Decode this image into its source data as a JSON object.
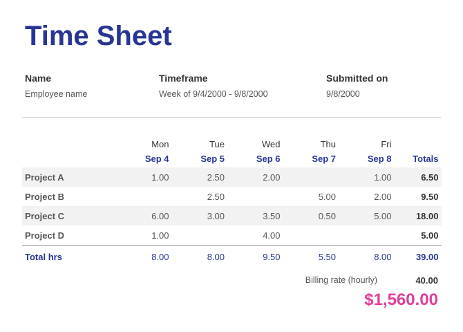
{
  "title": "Time Sheet",
  "meta": {
    "name_label": "Name",
    "name_value": "Employee name",
    "timeframe_label": "Timeframe",
    "timeframe_value": "Week of 9/4/2000 - 9/8/2000",
    "submitted_label": "Submitted on",
    "submitted_value": "9/8/2000"
  },
  "columns": {
    "days": [
      "Mon",
      "Tue",
      "Wed",
      "Thu",
      "Fri"
    ],
    "dates": [
      "Sep 4",
      "Sep 5",
      "Sep 6",
      "Sep 7",
      "Sep 8"
    ],
    "totals_label": "Totals"
  },
  "rows": [
    {
      "label": "Project A",
      "cells": [
        "1.00",
        "2.50",
        "2.00",
        "",
        "1.00"
      ],
      "total": "6.50"
    },
    {
      "label": "Project B",
      "cells": [
        "",
        "2.50",
        "",
        "5.00",
        "2.00"
      ],
      "total": "9.50"
    },
    {
      "label": "Project C",
      "cells": [
        "6.00",
        "3.00",
        "3.50",
        "0.50",
        "5.00"
      ],
      "total": "18.00"
    },
    {
      "label": "Project D",
      "cells": [
        "1.00",
        "",
        "4.00",
        "",
        ""
      ],
      "total": "5.00"
    }
  ],
  "summary": {
    "label": "Total hrs",
    "cells": [
      "8.00",
      "8.00",
      "9.50",
      "5.50",
      "8.00"
    ],
    "total": "39.00"
  },
  "billing": {
    "rate_label": "Billing rate (hourly)",
    "rate_value": "40.00",
    "amount": "$1,560.00"
  },
  "colors": {
    "accent": "#283593",
    "amount": "#e0409a"
  }
}
